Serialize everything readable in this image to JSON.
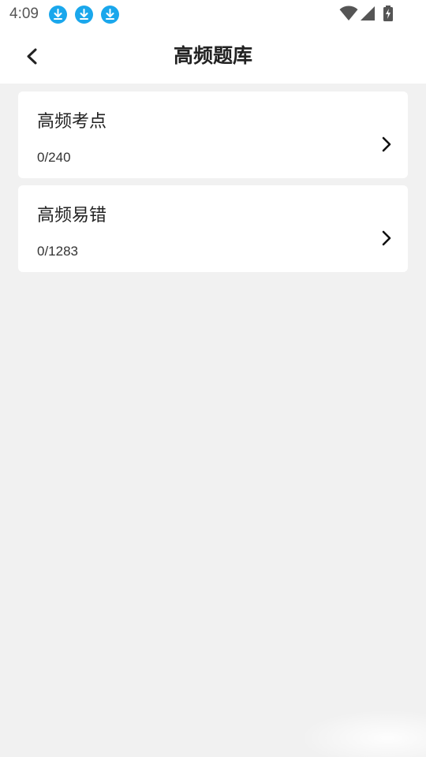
{
  "status_bar": {
    "time": "4:09",
    "notification_icons": [
      "download-icon",
      "download-icon",
      "download-icon"
    ],
    "right_icons": [
      "wifi-icon",
      "signal-icon",
      "battery-charging-icon"
    ]
  },
  "nav": {
    "title": "高频题库",
    "back_icon": "back-arrow-icon"
  },
  "items": [
    {
      "title": "高频考点",
      "progress": "0/240",
      "done": 0,
      "total": 240
    },
    {
      "title": "高频易错",
      "progress": "0/1283",
      "done": 0,
      "total": 1283
    }
  ],
  "colors": {
    "background": "#f1f1f1",
    "card": "#ffffff",
    "download_badge": "#1aa7ec",
    "text": "#222222"
  }
}
